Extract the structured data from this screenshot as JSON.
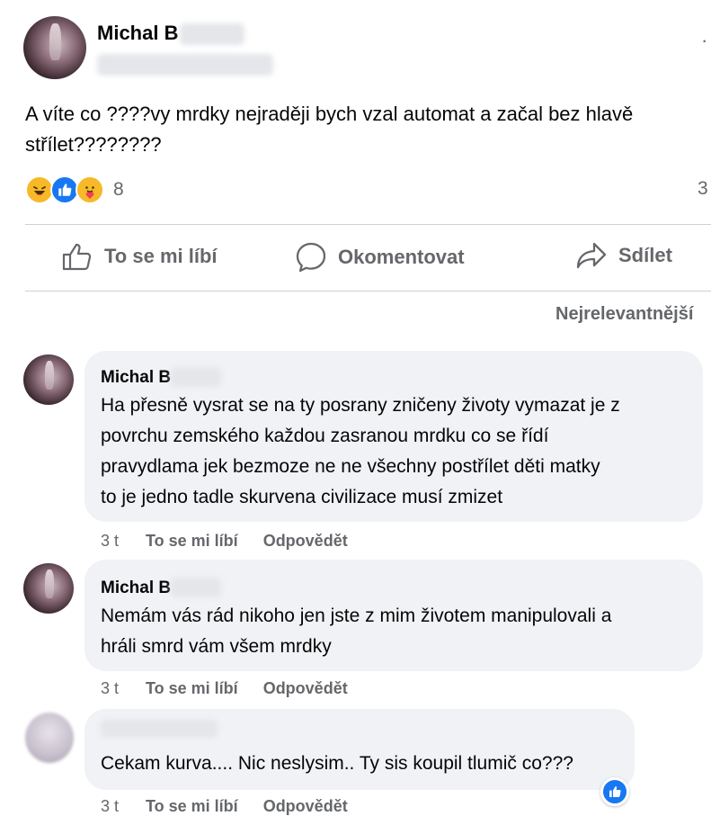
{
  "post": {
    "author": "Michal B",
    "more_glyph": "·",
    "text": "A víte co ????vy mrdky nejraději bych vzal automat a začal bez hlavě střílet????????",
    "reactions": {
      "icons": [
        "haha-icon",
        "like-icon",
        "care-icon"
      ],
      "count": "8"
    },
    "comment_count": "3"
  },
  "actions": {
    "like": "To se mi líbí",
    "comment": "Okomentovat",
    "share": "Sdílet"
  },
  "sort_label": "Nejrelevantnější",
  "comments": [
    {
      "author": "Michal B",
      "lines": [
        "Ha přesně vysrat se na ty posrany zničeny životy vymazat je z",
        "povrchu zemského každou zasranou mrdku co se řídí",
        "pravydlama jek bezmoze ne ne všechny postřílet děti matky",
        "to je jedno tadle skurvena civilizace musí zmizet"
      ],
      "time": "3 t",
      "like": "To se mi líbí",
      "reply": "Odpovědět"
    },
    {
      "author": "Michal B",
      "lines": [
        "Nemám vás rád nikoho jen jste z mim životem manipulovali a",
        "hráli smrd vám všem mrdky"
      ],
      "time": "3 t",
      "like": "To se mi líbí",
      "reply": "Odpovědět"
    },
    {
      "author": "",
      "lines": [
        "Cekam kurva.... Nic neslysim.. Ty sis koupil tlumič co???"
      ],
      "time": "3 t",
      "like": "To se mi líbí",
      "reply": "Odpovědět"
    }
  ],
  "colors": {
    "accent": "#1877f2",
    "bubble": "#f0f2f5",
    "muted": "#65676b",
    "divider": "#ced0d4"
  }
}
